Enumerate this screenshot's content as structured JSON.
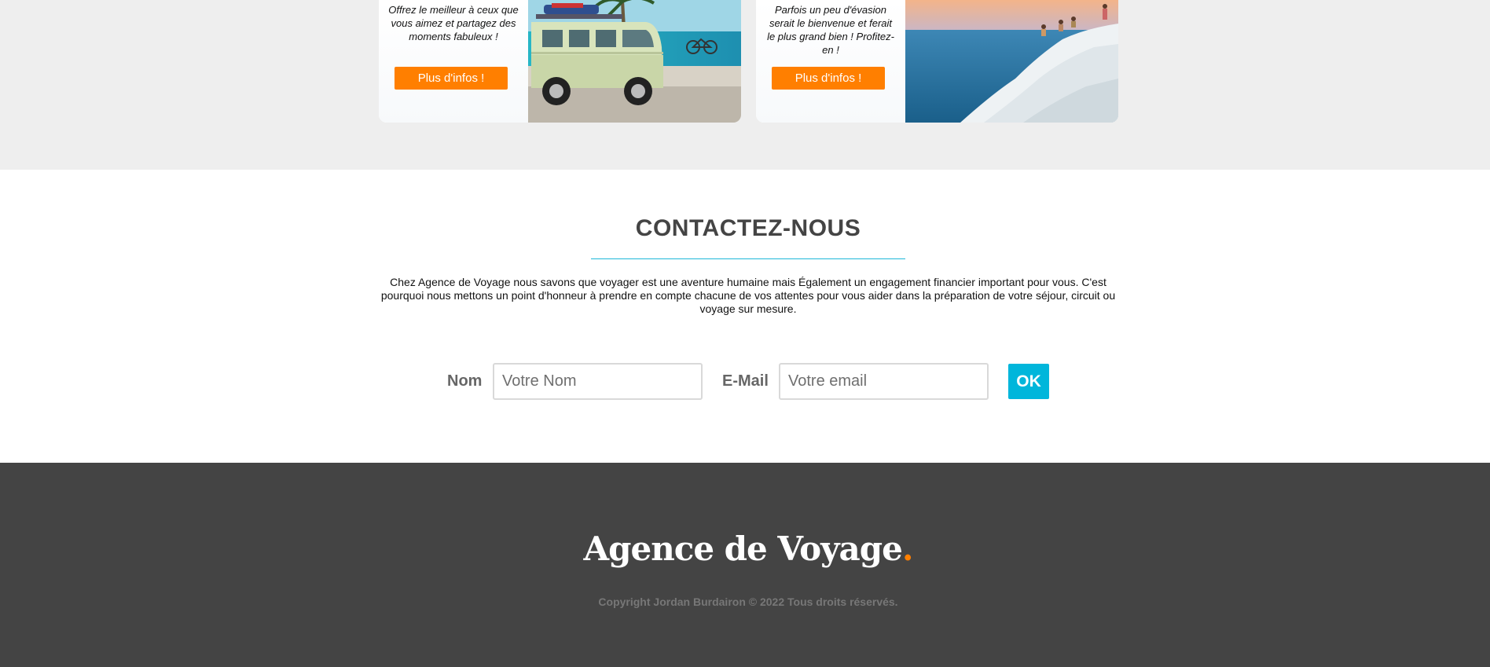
{
  "cards": [
    {
      "description": "Offrez le meilleur à ceux que vous aimez et partagez des moments fabuleux !",
      "button_label": "Plus d'infos !"
    },
    {
      "description": "Parfois un peu d'évasion serait le bienvenue et ferait le plus grand bien ! Profitez-en !",
      "button_label": "Plus d'infos !"
    }
  ],
  "contact": {
    "title": "CONTACTEZ-NOUS",
    "text": "Chez Agence de Voyage nous savons que voyager est une aventure humaine mais Également un engagement financier important pour vous. C'est pourquoi nous mettons un point d'honneur à prendre en compte chacune de vos attentes pour vous aider dans la préparation de votre séjour, circuit ou voyage sur mesure.",
    "form": {
      "name_label": "Nom",
      "name_placeholder": "Votre Nom",
      "email_label": "E-Mail",
      "email_placeholder": "Votre email",
      "submit_label": "OK"
    }
  },
  "footer": {
    "brand": "Agence de Voyage",
    "brand_dot": ".",
    "copyright": "Copyright Jordan Burdairon © 2022 Tous droits réservés."
  },
  "colors": {
    "accent_orange": "#ff7f00",
    "accent_cyan": "#00b6db",
    "footer_bg": "#444444",
    "section_bg": "#eeeeee"
  }
}
